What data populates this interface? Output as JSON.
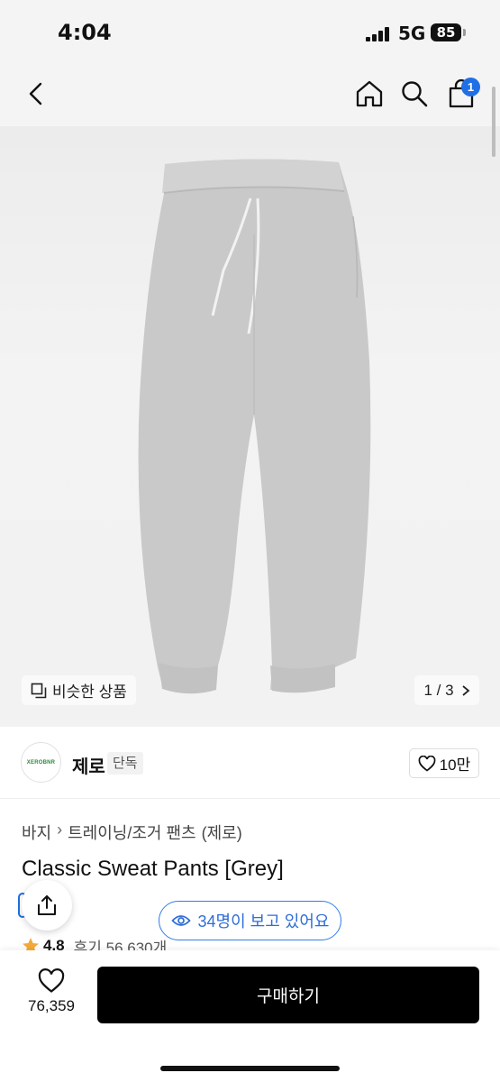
{
  "status": {
    "time": "4:04",
    "network": "5G",
    "battery": "85"
  },
  "nav": {
    "cart_count": "1"
  },
  "gallery": {
    "similar_label": "비슷한 상품",
    "pager": "1 / 3"
  },
  "brand": {
    "name": "제로",
    "logo_text": "XEROBNR",
    "tag": "단독",
    "likes": "10만"
  },
  "breadcrumb": [
    "바지",
    "트레이닝/조거 팬츠",
    "(제로)"
  ],
  "product": {
    "title": "Classic Sweat Pants [Grey]",
    "viewers": "34명이 보고 있어요",
    "rating": "4.8",
    "reviews": "후기 56,630개"
  },
  "bottom": {
    "wish_count": "76,359",
    "buy_label": "구매하기"
  },
  "colors": {
    "accent": "#1f6fe5",
    "buy_button": "#000000",
    "star": "#f2a93b"
  }
}
